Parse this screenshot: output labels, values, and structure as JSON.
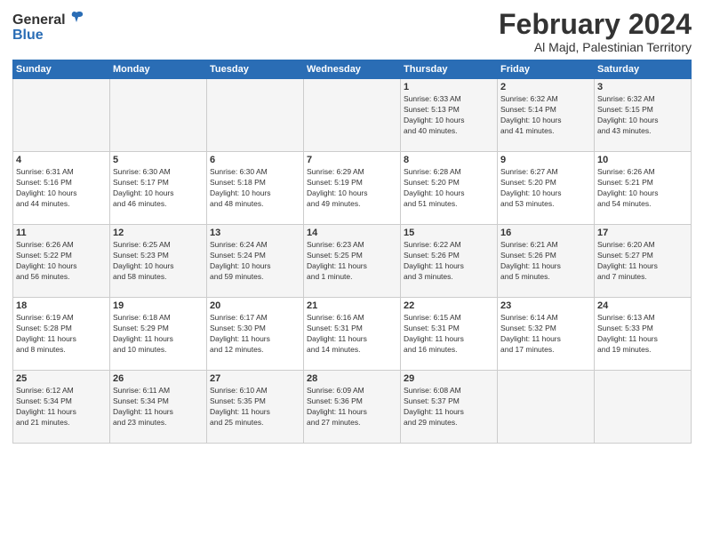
{
  "logo": {
    "general": "General",
    "blue": "Blue"
  },
  "title": "February 2024",
  "location": "Al Majd, Palestinian Territory",
  "days_header": [
    "Sunday",
    "Monday",
    "Tuesday",
    "Wednesday",
    "Thursday",
    "Friday",
    "Saturday"
  ],
  "weeks": [
    [
      {
        "day": "",
        "info": ""
      },
      {
        "day": "",
        "info": ""
      },
      {
        "day": "",
        "info": ""
      },
      {
        "day": "",
        "info": ""
      },
      {
        "day": "1",
        "info": "Sunrise: 6:33 AM\nSunset: 5:13 PM\nDaylight: 10 hours\nand 40 minutes."
      },
      {
        "day": "2",
        "info": "Sunrise: 6:32 AM\nSunset: 5:14 PM\nDaylight: 10 hours\nand 41 minutes."
      },
      {
        "day": "3",
        "info": "Sunrise: 6:32 AM\nSunset: 5:15 PM\nDaylight: 10 hours\nand 43 minutes."
      }
    ],
    [
      {
        "day": "4",
        "info": "Sunrise: 6:31 AM\nSunset: 5:16 PM\nDaylight: 10 hours\nand 44 minutes."
      },
      {
        "day": "5",
        "info": "Sunrise: 6:30 AM\nSunset: 5:17 PM\nDaylight: 10 hours\nand 46 minutes."
      },
      {
        "day": "6",
        "info": "Sunrise: 6:30 AM\nSunset: 5:18 PM\nDaylight: 10 hours\nand 48 minutes."
      },
      {
        "day": "7",
        "info": "Sunrise: 6:29 AM\nSunset: 5:19 PM\nDaylight: 10 hours\nand 49 minutes."
      },
      {
        "day": "8",
        "info": "Sunrise: 6:28 AM\nSunset: 5:20 PM\nDaylight: 10 hours\nand 51 minutes."
      },
      {
        "day": "9",
        "info": "Sunrise: 6:27 AM\nSunset: 5:20 PM\nDaylight: 10 hours\nand 53 minutes."
      },
      {
        "day": "10",
        "info": "Sunrise: 6:26 AM\nSunset: 5:21 PM\nDaylight: 10 hours\nand 54 minutes."
      }
    ],
    [
      {
        "day": "11",
        "info": "Sunrise: 6:26 AM\nSunset: 5:22 PM\nDaylight: 10 hours\nand 56 minutes."
      },
      {
        "day": "12",
        "info": "Sunrise: 6:25 AM\nSunset: 5:23 PM\nDaylight: 10 hours\nand 58 minutes."
      },
      {
        "day": "13",
        "info": "Sunrise: 6:24 AM\nSunset: 5:24 PM\nDaylight: 10 hours\nand 59 minutes."
      },
      {
        "day": "14",
        "info": "Sunrise: 6:23 AM\nSunset: 5:25 PM\nDaylight: 11 hours\nand 1 minute."
      },
      {
        "day": "15",
        "info": "Sunrise: 6:22 AM\nSunset: 5:26 PM\nDaylight: 11 hours\nand 3 minutes."
      },
      {
        "day": "16",
        "info": "Sunrise: 6:21 AM\nSunset: 5:26 PM\nDaylight: 11 hours\nand 5 minutes."
      },
      {
        "day": "17",
        "info": "Sunrise: 6:20 AM\nSunset: 5:27 PM\nDaylight: 11 hours\nand 7 minutes."
      }
    ],
    [
      {
        "day": "18",
        "info": "Sunrise: 6:19 AM\nSunset: 5:28 PM\nDaylight: 11 hours\nand 8 minutes."
      },
      {
        "day": "19",
        "info": "Sunrise: 6:18 AM\nSunset: 5:29 PM\nDaylight: 11 hours\nand 10 minutes."
      },
      {
        "day": "20",
        "info": "Sunrise: 6:17 AM\nSunset: 5:30 PM\nDaylight: 11 hours\nand 12 minutes."
      },
      {
        "day": "21",
        "info": "Sunrise: 6:16 AM\nSunset: 5:31 PM\nDaylight: 11 hours\nand 14 minutes."
      },
      {
        "day": "22",
        "info": "Sunrise: 6:15 AM\nSunset: 5:31 PM\nDaylight: 11 hours\nand 16 minutes."
      },
      {
        "day": "23",
        "info": "Sunrise: 6:14 AM\nSunset: 5:32 PM\nDaylight: 11 hours\nand 17 minutes."
      },
      {
        "day": "24",
        "info": "Sunrise: 6:13 AM\nSunset: 5:33 PM\nDaylight: 11 hours\nand 19 minutes."
      }
    ],
    [
      {
        "day": "25",
        "info": "Sunrise: 6:12 AM\nSunset: 5:34 PM\nDaylight: 11 hours\nand 21 minutes."
      },
      {
        "day": "26",
        "info": "Sunrise: 6:11 AM\nSunset: 5:34 PM\nDaylight: 11 hours\nand 23 minutes."
      },
      {
        "day": "27",
        "info": "Sunrise: 6:10 AM\nSunset: 5:35 PM\nDaylight: 11 hours\nand 25 minutes."
      },
      {
        "day": "28",
        "info": "Sunrise: 6:09 AM\nSunset: 5:36 PM\nDaylight: 11 hours\nand 27 minutes."
      },
      {
        "day": "29",
        "info": "Sunrise: 6:08 AM\nSunset: 5:37 PM\nDaylight: 11 hours\nand 29 minutes."
      },
      {
        "day": "",
        "info": ""
      },
      {
        "day": "",
        "info": ""
      }
    ]
  ]
}
